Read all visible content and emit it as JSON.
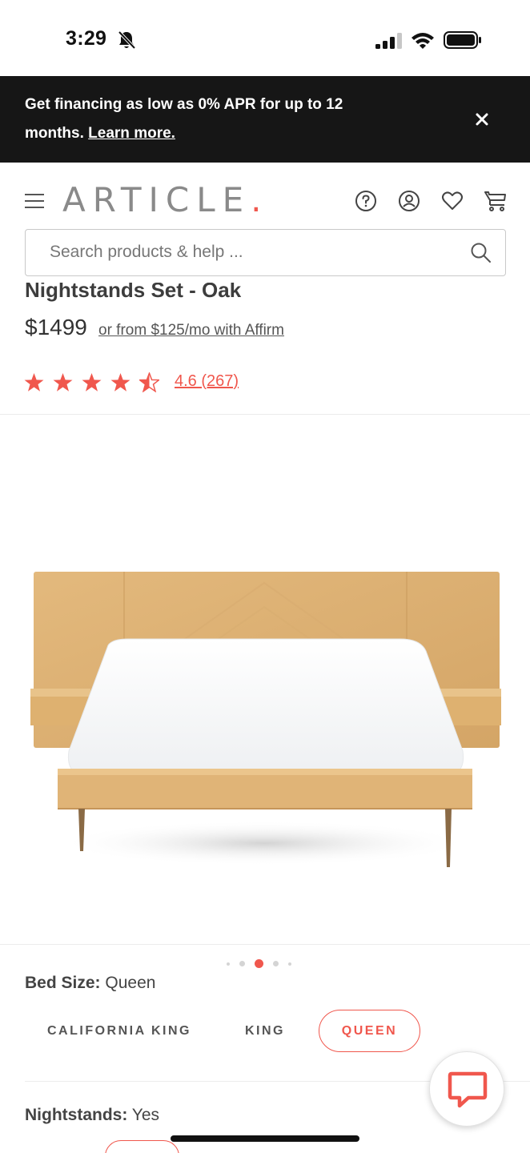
{
  "status_bar": {
    "time": "3:29"
  },
  "promo": {
    "text": "Get financing as low as 0% APR for up to 12 months.",
    "link": "Learn more."
  },
  "header": {
    "logo": "ARTICLE",
    "logo_dot": ".",
    "search_placeholder": "Search products & help ..."
  },
  "product": {
    "title": "Nightstands Set - Oak",
    "price": "$1499",
    "affirm": "or from $125/mo with Affirm",
    "rating_value": 4.6,
    "rating_text": "4.6 (267)"
  },
  "gallery": {
    "image_count": 5,
    "active_index": 2
  },
  "options": {
    "bed_size_label": "Bed Size:",
    "bed_size_value": "Queen",
    "sizes": [
      "CALIFORNIA KING",
      "KING",
      "QUEEN"
    ],
    "selected_size": "QUEEN",
    "nightstands_label": "Nightstands:",
    "nightstands_value": "Yes"
  },
  "colors": {
    "accent": "#f0574d",
    "banner": "#161616"
  }
}
